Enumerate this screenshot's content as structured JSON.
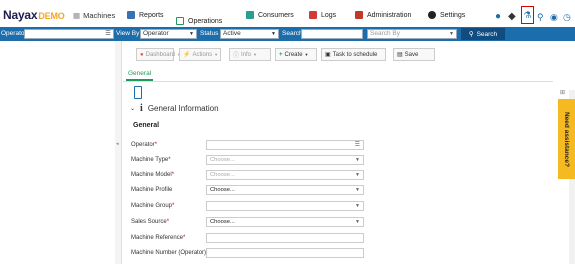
{
  "brand": {
    "name": "Nayax",
    "demo": "DEMO"
  },
  "nav": {
    "machines": "Machines",
    "tabs": [
      {
        "label": "Reports"
      },
      {
        "label": "Operations"
      },
      {
        "label": "Consumers"
      },
      {
        "label": "Logs"
      },
      {
        "label": "Administration"
      },
      {
        "label": "Settings"
      }
    ]
  },
  "filter": {
    "operator_label": "Operator",
    "view_by_label": "View By",
    "view_by_value": "Operator",
    "status_label": "Status",
    "status_value": "Active",
    "search_label": "Search",
    "search_by_placeholder": "Search By",
    "search_button": "Search"
  },
  "toolbar": {
    "dashboard": "Dashboard",
    "actions": "Actions",
    "info": "Info",
    "create": "Create",
    "task": "Task to schedule",
    "save": "Save"
  },
  "tabs": {
    "general": "General"
  },
  "section": {
    "title": "General Information",
    "subtitle": "General"
  },
  "form": {
    "fields": [
      {
        "label": "Operator",
        "required": true,
        "value": "",
        "type": "list"
      },
      {
        "label": "Machine Type",
        "required": true,
        "value": "Choose...",
        "placeholder": true
      },
      {
        "label": "Machine Model",
        "required": true,
        "value": "Choose...",
        "placeholder": true
      },
      {
        "label": "Machine Profile",
        "required": false,
        "value": "Choose..."
      },
      {
        "label": "Machine Group",
        "required": true,
        "value": ""
      },
      {
        "label": "Sales Source",
        "required": true,
        "value": "Choose..."
      },
      {
        "label": "Machine Reference",
        "required": true,
        "value": ""
      },
      {
        "label": "Machine Number (Operator)",
        "required": false,
        "value": ""
      }
    ]
  },
  "help": {
    "label": "Need assistance?"
  },
  "colors": {
    "accent": "#1e9b5a",
    "filterbar": "#1c6dab",
    "help": "#f5b922",
    "highlight": "#dd0000"
  }
}
